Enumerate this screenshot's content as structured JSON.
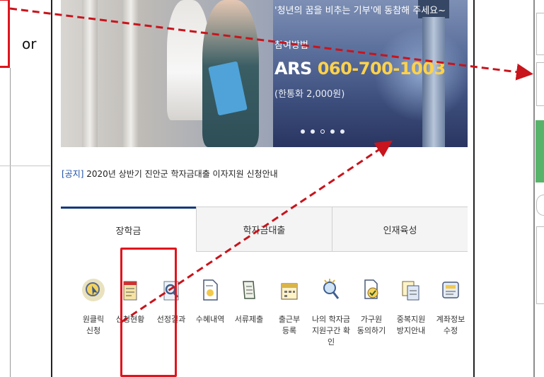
{
  "annotation": {
    "or_text": "or"
  },
  "banner": {
    "slogan": "'청년의 꿈을 비추는 기부'에 동참해 주세요~",
    "participate_label": "참여방법",
    "ars_prefix": "ARS ",
    "ars_number": "060-700-1003",
    "fee": "(한통화 2,000원)",
    "carousel_dots": 5
  },
  "notice": {
    "tag": "[공지]",
    "text": " 2020년 상반기 진안군 학자금대출 이자지원 신청안내"
  },
  "tabs": [
    {
      "label": "장학금",
      "active": true
    },
    {
      "label": "학자금대출",
      "active": false
    },
    {
      "label": "인재육성",
      "active": false
    }
  ],
  "menu": [
    {
      "line1": "원클릭",
      "line2": "신청",
      "icon": "one-click-apply-icon"
    },
    {
      "line1": "신청현황",
      "line2": "",
      "icon": "application-status-icon"
    },
    {
      "line1": "선정결과",
      "line2": "",
      "icon": "selection-result-icon"
    },
    {
      "line1": "수혜내역",
      "line2": "",
      "icon": "benefit-history-icon"
    },
    {
      "line1": "서류제출",
      "line2": "",
      "icon": "document-submit-icon"
    },
    {
      "line1": "출근부",
      "line2": "등록",
      "icon": "attendance-register-icon"
    },
    {
      "line1": "나의 학자금",
      "line2": "지원구간 확인",
      "icon": "support-bracket-icon"
    },
    {
      "line1": "가구원",
      "line2": "동의하기",
      "icon": "household-consent-icon"
    },
    {
      "line1": "중복지원",
      "line2": "방지안내",
      "icon": "duplicate-prevention-icon"
    },
    {
      "line1": "계좌정보",
      "line2": "수정",
      "icon": "account-edit-icon"
    }
  ],
  "colors": {
    "accent_red": "#e0141e",
    "tab_active": "#143a78",
    "ars_highlight": "#ffd24a",
    "notice_tag": "#1d4fa8"
  }
}
